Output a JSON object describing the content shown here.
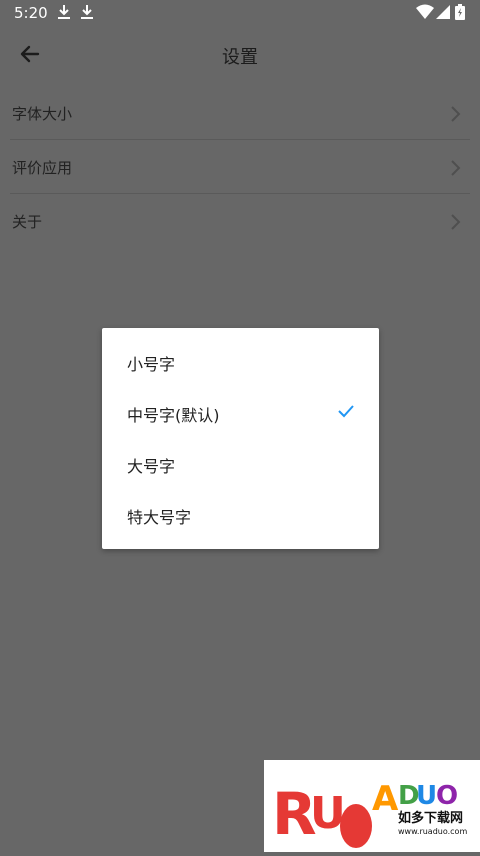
{
  "status_bar": {
    "time": "5:20",
    "icons": [
      "download-icon",
      "download-icon",
      "wifi-icon",
      "signal-icon",
      "battery-charging-icon"
    ]
  },
  "app_bar": {
    "title": "设置",
    "back_icon": "arrow-left-icon"
  },
  "settings": [
    {
      "label": "字体大小",
      "icon": "chevron-right-icon"
    },
    {
      "label": "评价应用",
      "icon": "chevron-right-icon"
    },
    {
      "label": "关于",
      "icon": "chevron-right-icon"
    }
  ],
  "font_size_dialog": {
    "options": [
      {
        "label": "小号字",
        "selected": false
      },
      {
        "label": "中号字(默认)",
        "selected": true
      },
      {
        "label": "大号字",
        "selected": false
      },
      {
        "label": "特大号字",
        "selected": false
      }
    ],
    "check_icon": "checkmark-icon",
    "accent_color": "#2196f3"
  },
  "watermark": {
    "logo_text": "RUANDUO",
    "tagline": "如多下载网",
    "url": "www.ruaduo.com"
  },
  "colors": {
    "scrim_background": "#676767",
    "dialog_background": "#ffffff",
    "text_primary": "#222222"
  }
}
